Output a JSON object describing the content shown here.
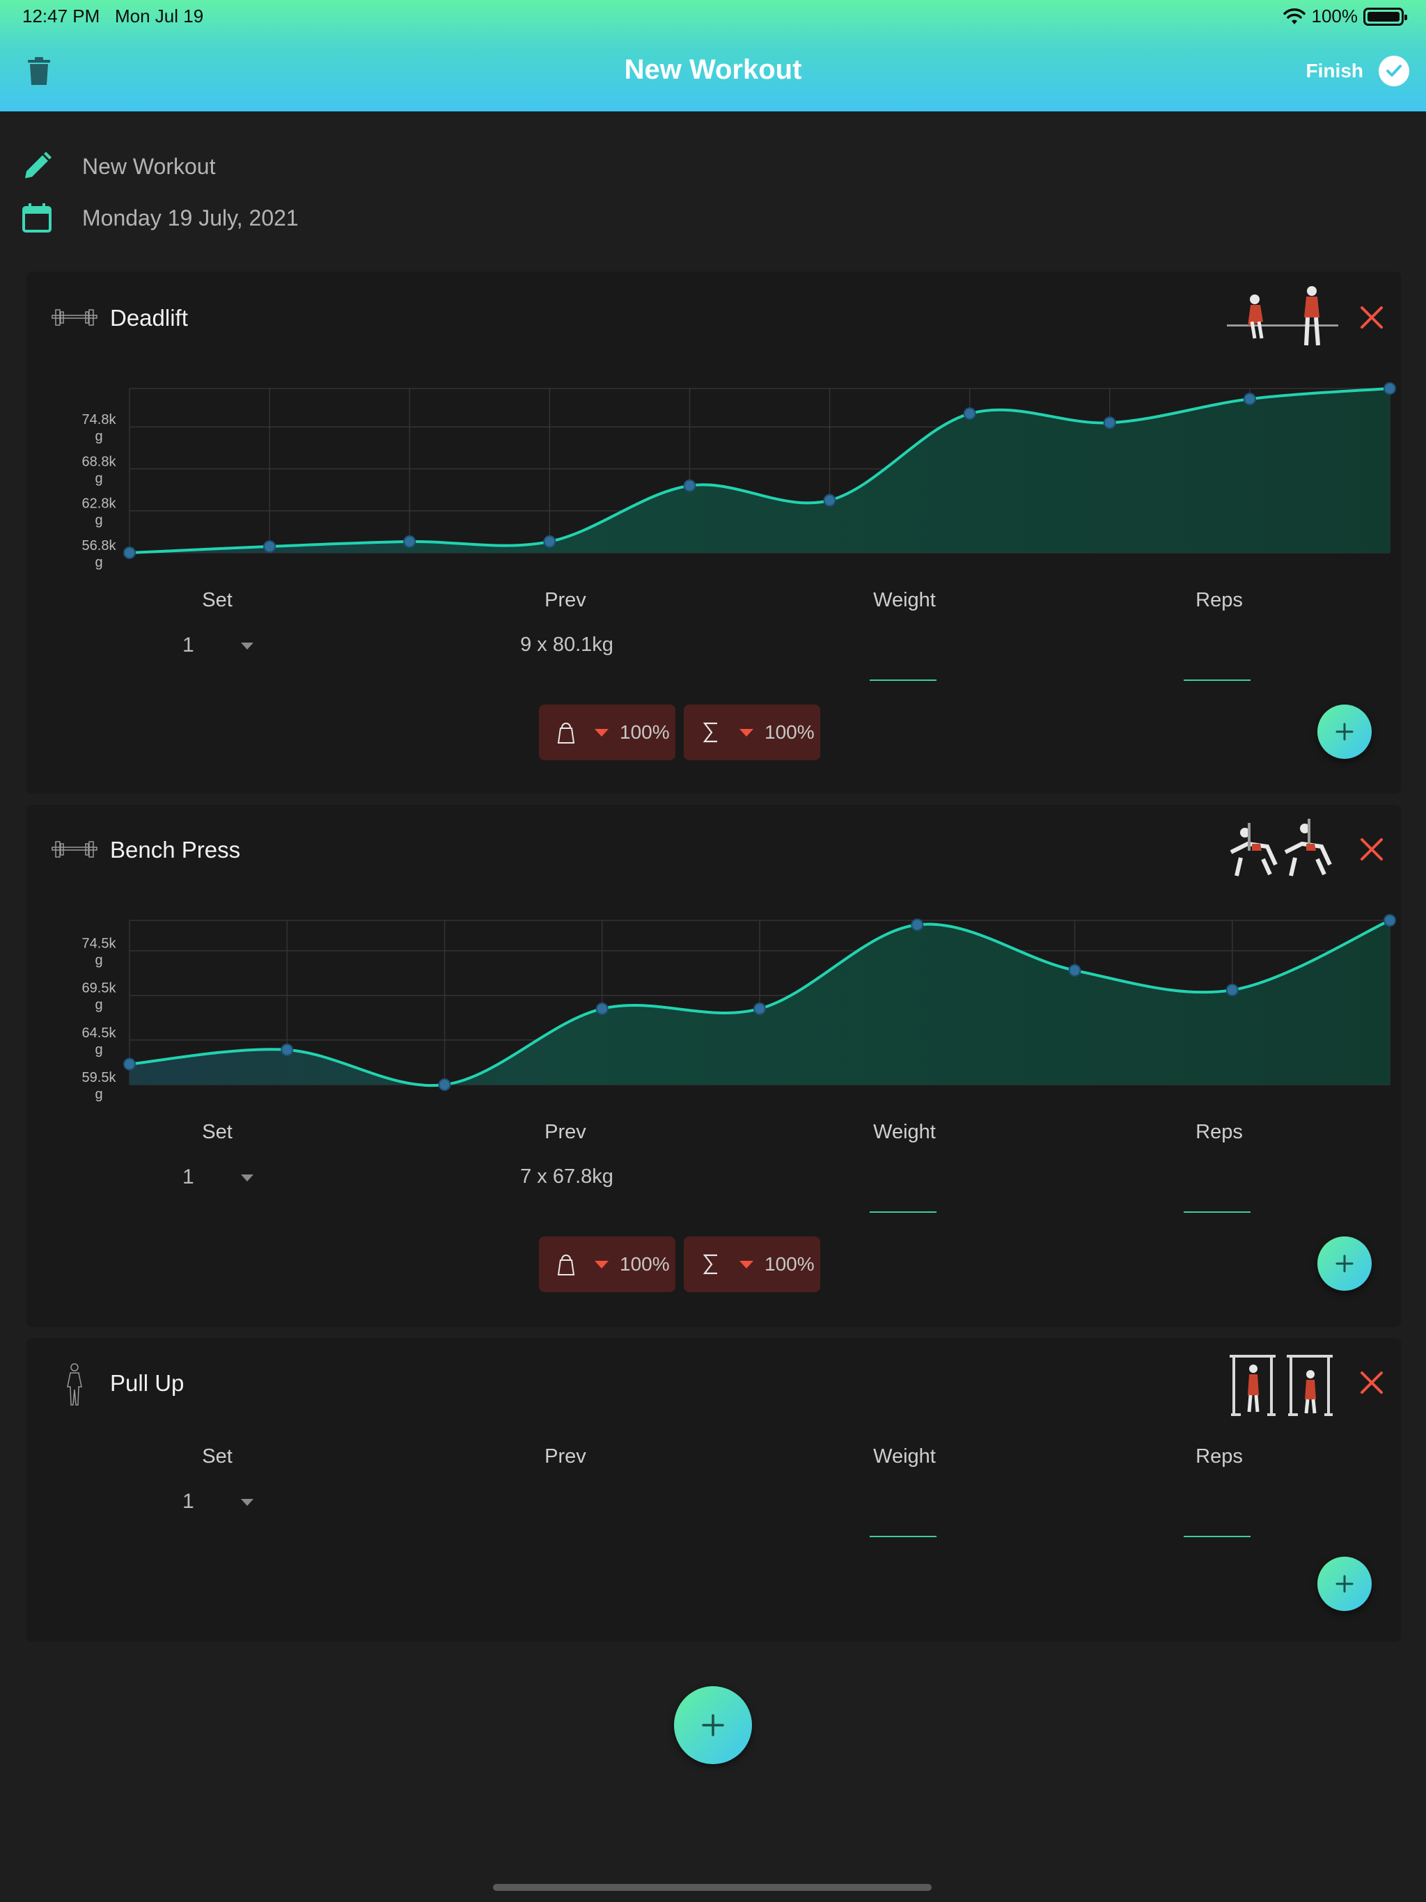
{
  "status_bar": {
    "time": "12:47 PM",
    "date": "Mon Jul 19",
    "battery": "100%"
  },
  "nav": {
    "title": "New Workout",
    "finish_label": "Finish"
  },
  "workout": {
    "name": "New Workout",
    "date": "Monday 19 July, 2021"
  },
  "columns": {
    "set": "Set",
    "prev": "Prev",
    "weight": "Weight",
    "reps": "Reps"
  },
  "colors": {
    "accent": "#2ed0a8",
    "line": "#22d3b0",
    "danger": "#f25140",
    "pill_bg": "#4b1f1d",
    "card_bg": "#191919"
  },
  "exercises": [
    {
      "name": "Deadlift",
      "icon": "barbell-icon",
      "set": {
        "number": "1",
        "prev": "9 x 80.1kg",
        "weight": "",
        "reps": ""
      },
      "pills": [
        {
          "icon": "kettlebell-icon",
          "value": "100%"
        },
        {
          "icon": "sigma-icon",
          "value": "100%"
        }
      ],
      "chart_data": {
        "type": "area",
        "y_ticks": [
          "74.8k\ng",
          "68.8k\ng",
          "62.8k\ng",
          "56.8k\ng"
        ],
        "y_tick_values": [
          74.8,
          68.8,
          62.8,
          56.8
        ],
        "ylim": [
          56.8,
          80.3
        ],
        "values": [
          56.8,
          57.7,
          58.4,
          58.4,
          66.4,
          64.3,
          76.7,
          75.4,
          78.8,
          80.3
        ]
      }
    },
    {
      "name": "Bench Press",
      "icon": "barbell-icon",
      "set": {
        "number": "1",
        "prev": "7 x 67.8kg",
        "weight": "",
        "reps": ""
      },
      "pills": [
        {
          "icon": "kettlebell-icon",
          "value": "100%"
        },
        {
          "icon": "sigma-icon",
          "value": "100%"
        }
      ],
      "chart_data": {
        "type": "area",
        "y_ticks": [
          "74.5k\ng",
          "69.5k\ng",
          "64.5k\ng",
          "59.5k\ng"
        ],
        "y_tick_values": [
          74.5,
          69.5,
          64.5,
          59.5
        ],
        "ylim": [
          59.5,
          77.9
        ],
        "values": [
          61.8,
          63.4,
          59.5,
          68.0,
          68.0,
          77.4,
          72.3,
          70.1,
          77.9
        ]
      }
    },
    {
      "name": "Pull Up",
      "icon": "body-icon",
      "set": {
        "number": "1",
        "prev": "",
        "weight": "",
        "reps": ""
      }
    }
  ]
}
